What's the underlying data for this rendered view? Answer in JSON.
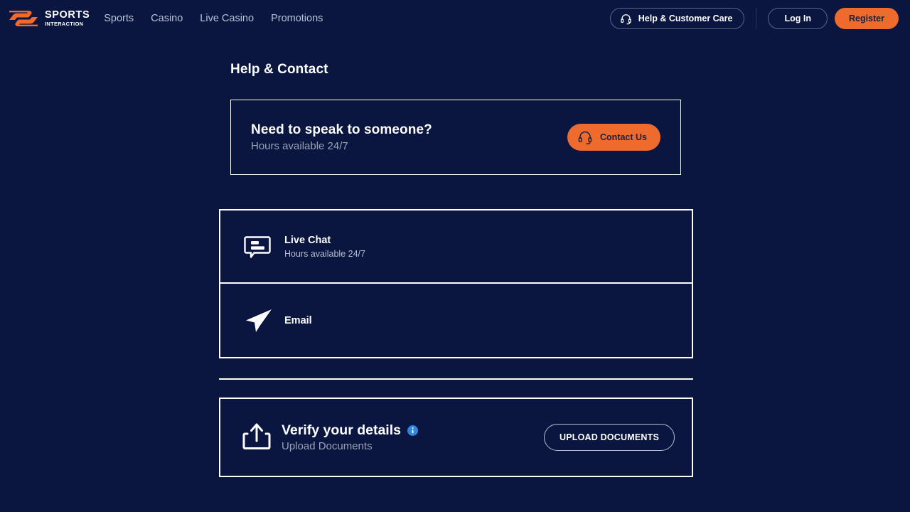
{
  "brand": {
    "logo_line1": "SPORTS",
    "logo_line2": "INTERACTION",
    "accent_color": "#ee6b2d",
    "background_color": "#0a1640",
    "info_color": "#2e86de"
  },
  "header": {
    "nav": [
      {
        "label": "Sports"
      },
      {
        "label": "Casino"
      },
      {
        "label": "Live Casino"
      },
      {
        "label": "Promotions"
      }
    ],
    "help_button": "Help & Customer Care",
    "login_button": "Log In",
    "register_button": "Register"
  },
  "page": {
    "title": "Help & Contact"
  },
  "speak_card": {
    "title": "Need to speak to someone?",
    "subtitle": "Hours available 24/7",
    "button_label": "Contact Us"
  },
  "channels": [
    {
      "title": "Live Chat",
      "subtitle": "Hours available 24/7",
      "icon": "chat-bubble-icon"
    },
    {
      "title": "Email",
      "subtitle": "",
      "icon": "paper-plane-icon"
    }
  ],
  "verify_card": {
    "title": "Verify your details",
    "subtitle": "Upload Documents",
    "button_label": "UPLOAD DOCUMENTS",
    "icon": "upload-icon",
    "info_icon": "info-icon"
  }
}
